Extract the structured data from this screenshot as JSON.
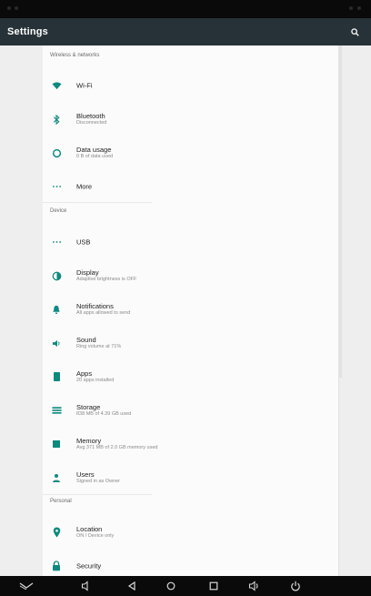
{
  "app_bar": {
    "title": "Settings",
    "search_icon": "search-icon"
  },
  "colors": {
    "accent": "#0e8a7f",
    "app_bar": "#263238",
    "system_bars": "#0a0a0a"
  },
  "sections": [
    {
      "header": "Wireless & networks",
      "items": [
        {
          "id": "wifi",
          "icon": "wifi-icon",
          "title": "Wi-Fi",
          "summary": ""
        },
        {
          "id": "bluetooth",
          "icon": "bluetooth-icon",
          "title": "Bluetooth",
          "summary": "Disconnected"
        },
        {
          "id": "data-usage",
          "icon": "data-usage-icon",
          "title": "Data usage",
          "summary": "0 B of data used"
        },
        {
          "id": "more",
          "icon": "more-icon",
          "title": "More",
          "summary": ""
        }
      ]
    },
    {
      "header": "Device",
      "items": [
        {
          "id": "usb",
          "icon": "usb-icon",
          "title": "USB",
          "summary": ""
        },
        {
          "id": "display",
          "icon": "display-icon",
          "title": "Display",
          "summary": "Adaptive brightness is OFF"
        },
        {
          "id": "notifications",
          "icon": "notifications-icon",
          "title": "Notifications",
          "summary": "All apps allowed to send"
        },
        {
          "id": "sound",
          "icon": "sound-icon",
          "title": "Sound",
          "summary": "Ring volume at 71%"
        },
        {
          "id": "apps",
          "icon": "apps-icon",
          "title": "Apps",
          "summary": "20 apps installed"
        },
        {
          "id": "storage",
          "icon": "storage-icon",
          "title": "Storage",
          "summary": "838 MB of 4.39 GB used"
        },
        {
          "id": "memory",
          "icon": "memory-icon",
          "title": "Memory",
          "summary": "Avg 371 MB of 2.0 GB memory used"
        },
        {
          "id": "users",
          "icon": "users-icon",
          "title": "Users",
          "summary": "Signed in as Owner"
        }
      ]
    },
    {
      "header": "Personal",
      "items": [
        {
          "id": "location",
          "icon": "location-icon",
          "title": "Location",
          "summary": "ON / Device only"
        },
        {
          "id": "security",
          "icon": "security-icon",
          "title": "Security",
          "summary": ""
        }
      ]
    }
  ],
  "nav_bar": {
    "buttons": [
      {
        "id": "hide-keyboard",
        "icon": "chevron-down-icon"
      },
      {
        "id": "volume-down",
        "icon": "volume-down-icon"
      },
      {
        "id": "back",
        "icon": "back-icon"
      },
      {
        "id": "home",
        "icon": "home-icon"
      },
      {
        "id": "recents",
        "icon": "recents-icon"
      },
      {
        "id": "volume-up",
        "icon": "volume-up-icon"
      },
      {
        "id": "power",
        "icon": "power-icon"
      }
    ]
  }
}
